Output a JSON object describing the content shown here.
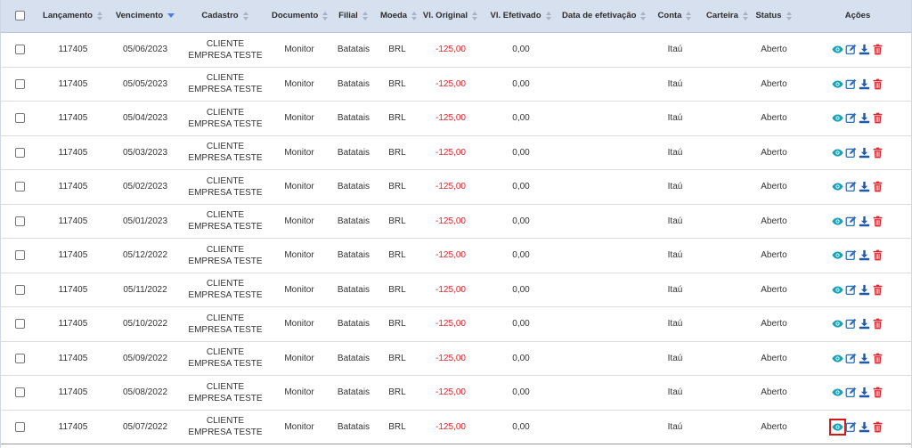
{
  "table": {
    "columns": [
      {
        "label": "",
        "sort": "none"
      },
      {
        "label": "Lançamento",
        "sort": "both"
      },
      {
        "label": "Vencimento",
        "sort": "desc"
      },
      {
        "label": "Cadastro",
        "sort": "both"
      },
      {
        "label": "Documento",
        "sort": "both"
      },
      {
        "label": "Filial",
        "sort": "both"
      },
      {
        "label": "Moeda",
        "sort": "both"
      },
      {
        "label": "Vl. Original",
        "sort": "both"
      },
      {
        "label": "Vl. Efetivado",
        "sort": "both"
      },
      {
        "label": "Data de efetivação",
        "sort": "both"
      },
      {
        "label": "Conta",
        "sort": "both"
      },
      {
        "label": "Carteira",
        "sort": "both"
      },
      {
        "label": "Status",
        "sort": "both"
      },
      {
        "label": "Ações",
        "sort": "none"
      }
    ],
    "rows": [
      {
        "lancamento": "117405",
        "vencimento": "05/06/2023",
        "cadastro": "CLIENTE EMPRESA TESTE",
        "documento": "Monitor",
        "filial": "Batatais",
        "moeda": "BRL",
        "vl_original": "-125,00",
        "vl_efetivado": "0,00",
        "data_efetivacao": "",
        "conta": "Itaú",
        "carteira": "",
        "status": "Aberto"
      },
      {
        "lancamento": "117405",
        "vencimento": "05/05/2023",
        "cadastro": "CLIENTE EMPRESA TESTE",
        "documento": "Monitor",
        "filial": "Batatais",
        "moeda": "BRL",
        "vl_original": "-125,00",
        "vl_efetivado": "0,00",
        "data_efetivacao": "",
        "conta": "Itaú",
        "carteira": "",
        "status": "Aberto"
      },
      {
        "lancamento": "117405",
        "vencimento": "05/04/2023",
        "cadastro": "CLIENTE EMPRESA TESTE",
        "documento": "Monitor",
        "filial": "Batatais",
        "moeda": "BRL",
        "vl_original": "-125,00",
        "vl_efetivado": "0,00",
        "data_efetivacao": "",
        "conta": "Itaú",
        "carteira": "",
        "status": "Aberto"
      },
      {
        "lancamento": "117405",
        "vencimento": "05/03/2023",
        "cadastro": "CLIENTE EMPRESA TESTE",
        "documento": "Monitor",
        "filial": "Batatais",
        "moeda": "BRL",
        "vl_original": "-125,00",
        "vl_efetivado": "0,00",
        "data_efetivacao": "",
        "conta": "Itaú",
        "carteira": "",
        "status": "Aberto"
      },
      {
        "lancamento": "117405",
        "vencimento": "05/02/2023",
        "cadastro": "CLIENTE EMPRESA TESTE",
        "documento": "Monitor",
        "filial": "Batatais",
        "moeda": "BRL",
        "vl_original": "-125,00",
        "vl_efetivado": "0,00",
        "data_efetivacao": "",
        "conta": "Itaú",
        "carteira": "",
        "status": "Aberto"
      },
      {
        "lancamento": "117405",
        "vencimento": "05/01/2023",
        "cadastro": "CLIENTE EMPRESA TESTE",
        "documento": "Monitor",
        "filial": "Batatais",
        "moeda": "BRL",
        "vl_original": "-125,00",
        "vl_efetivado": "0,00",
        "data_efetivacao": "",
        "conta": "Itaú",
        "carteira": "",
        "status": "Aberto"
      },
      {
        "lancamento": "117405",
        "vencimento": "05/12/2022",
        "cadastro": "CLIENTE EMPRESA TESTE",
        "documento": "Monitor",
        "filial": "Batatais",
        "moeda": "BRL",
        "vl_original": "-125,00",
        "vl_efetivado": "0,00",
        "data_efetivacao": "",
        "conta": "Itaú",
        "carteira": "",
        "status": "Aberto"
      },
      {
        "lancamento": "117405",
        "vencimento": "05/11/2022",
        "cadastro": "CLIENTE EMPRESA TESTE",
        "documento": "Monitor",
        "filial": "Batatais",
        "moeda": "BRL",
        "vl_original": "-125,00",
        "vl_efetivado": "0,00",
        "data_efetivacao": "",
        "conta": "Itaú",
        "carteira": "",
        "status": "Aberto"
      },
      {
        "lancamento": "117405",
        "vencimento": "05/10/2022",
        "cadastro": "CLIENTE EMPRESA TESTE",
        "documento": "Monitor",
        "filial": "Batatais",
        "moeda": "BRL",
        "vl_original": "-125,00",
        "vl_efetivado": "0,00",
        "data_efetivacao": "",
        "conta": "Itaú",
        "carteira": "",
        "status": "Aberto"
      },
      {
        "lancamento": "117405",
        "vencimento": "05/09/2022",
        "cadastro": "CLIENTE EMPRESA TESTE",
        "documento": "Monitor",
        "filial": "Batatais",
        "moeda": "BRL",
        "vl_original": "-125,00",
        "vl_efetivado": "0,00",
        "data_efetivacao": "",
        "conta": "Itaú",
        "carteira": "",
        "status": "Aberto"
      },
      {
        "lancamento": "117405",
        "vencimento": "05/08/2022",
        "cadastro": "CLIENTE EMPRESA TESTE",
        "documento": "Monitor",
        "filial": "Batatais",
        "moeda": "BRL",
        "vl_original": "-125,00",
        "vl_efetivado": "0,00",
        "data_efetivacao": "",
        "conta": "Itaú",
        "carteira": "",
        "status": "Aberto"
      },
      {
        "lancamento": "117405",
        "vencimento": "05/07/2022",
        "cadastro": "CLIENTE EMPRESA TESTE",
        "documento": "Monitor",
        "filial": "Batatais",
        "moeda": "BRL",
        "vl_original": "-125,00",
        "vl_efetivado": "0,00",
        "data_efetivacao": "",
        "conta": "Itaú",
        "carteira": "",
        "status": "Aberto",
        "highlight_view": true
      }
    ]
  },
  "actions": [
    "eye-icon",
    "edit-icon",
    "download-icon",
    "trash-icon"
  ],
  "colors": {
    "header_bg": "#d6e0ef",
    "negative": "#e4222b",
    "view_icon": "#17a2b8",
    "edit_icon": "#2c6fb8",
    "download_icon": "#1f5aa6",
    "delete_icon": "#d9262e",
    "highlight": "#d41717"
  }
}
